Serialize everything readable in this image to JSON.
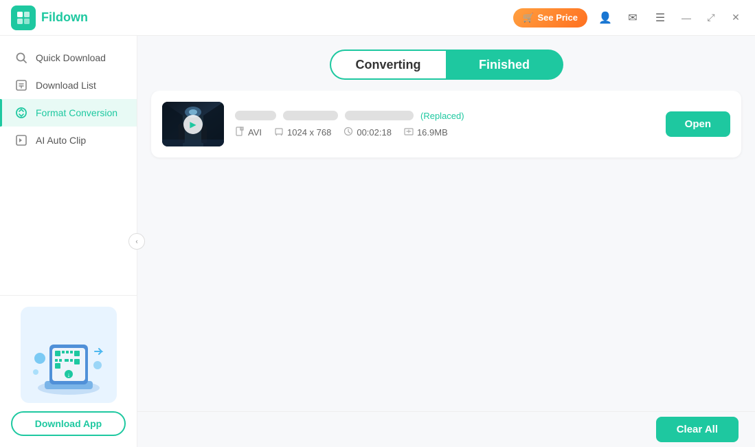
{
  "app": {
    "logo": "F",
    "name": "Fildown"
  },
  "titlebar": {
    "see_price": "See Price",
    "cart_icon": "🛒",
    "user_icon": "👤",
    "mail_icon": "✉",
    "menu_icon": "☰",
    "minimize_icon": "—",
    "restore_icon": "⤢",
    "close_icon": "✕"
  },
  "sidebar": {
    "items": [
      {
        "id": "quick-download",
        "label": "Quick Download",
        "icon": "🔍",
        "active": false
      },
      {
        "id": "download-list",
        "label": "Download List",
        "icon": "📥",
        "active": false
      },
      {
        "id": "format-conversion",
        "label": "Format Conversion",
        "icon": "🔄",
        "active": true
      },
      {
        "id": "ai-auto-clip",
        "label": "AI Auto Clip",
        "icon": "✂️",
        "active": false
      }
    ],
    "download_app_label": "Download App"
  },
  "tabs": {
    "converting_label": "Converting",
    "finished_label": "Finished",
    "active": "finished"
  },
  "files": [
    {
      "id": "file-1",
      "badge": "(Replaced)",
      "format": "AVI",
      "resolution": "1024 x 768",
      "duration": "00:02:18",
      "size": "16.9MB",
      "open_label": "Open"
    }
  ],
  "bottom": {
    "clear_all_label": "Clear All"
  }
}
